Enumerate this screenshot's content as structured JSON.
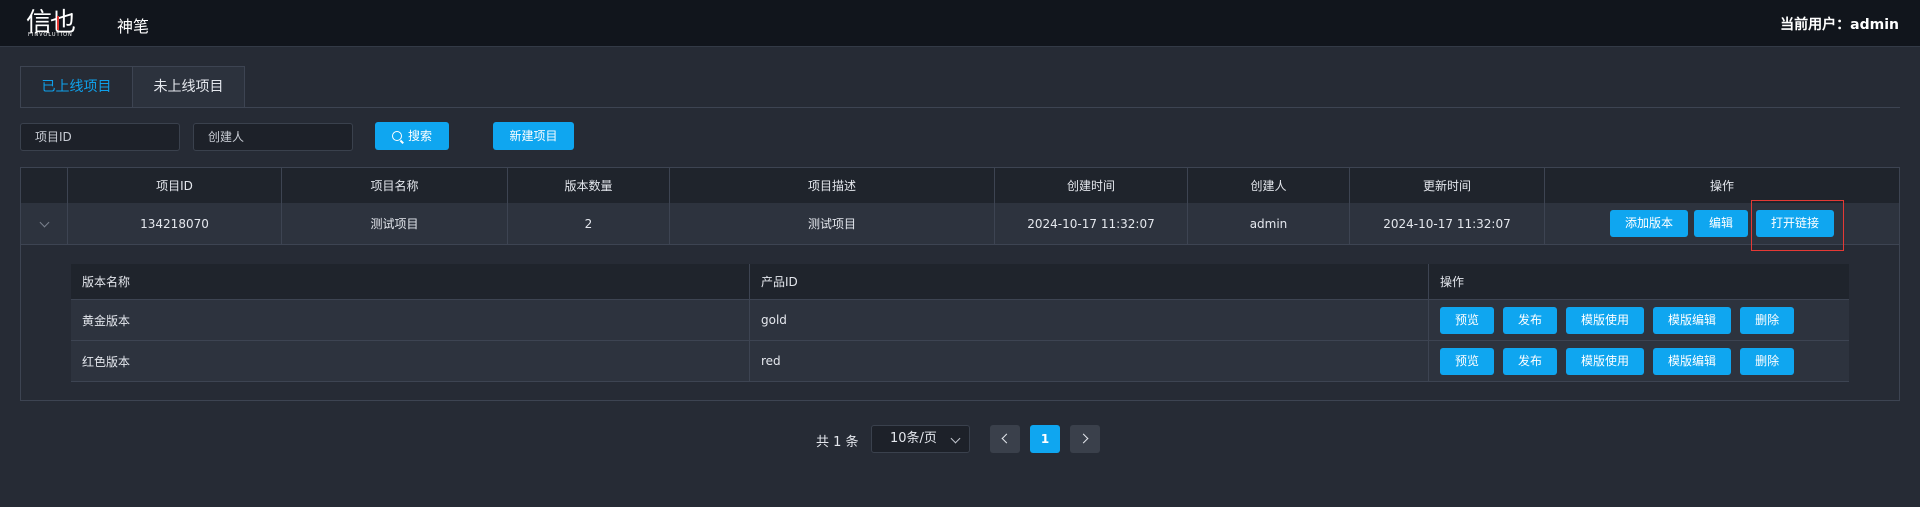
{
  "header": {
    "logo_text": "信也",
    "logo_sub": "FINVOLUTION",
    "app_name": "神笔",
    "user_info": "当前用户：admin"
  },
  "tabs": [
    {
      "label": "已上线项目",
      "active": true
    },
    {
      "label": "未上线项目",
      "active": false
    }
  ],
  "filters": {
    "project_id_placeholder": "项目ID",
    "creator_placeholder": "创建人",
    "search_label": "搜索",
    "new_project_label": "新建项目"
  },
  "table": {
    "columns": [
      "",
      "项目ID",
      "项目名称",
      "版本数量",
      "项目描述",
      "创建时间",
      "创建人",
      "更新时间",
      "操作"
    ],
    "rows": [
      {
        "project_id": "134218070",
        "project_name": "测试项目",
        "version_count": "2",
        "description": "测试项目",
        "created_at": "2024-10-17 11:32:07",
        "creator": "admin",
        "updated_at": "2024-10-17 11:32:07",
        "actions": [
          "添加版本",
          "编辑",
          "打开链接"
        ]
      }
    ]
  },
  "versions": {
    "columns": [
      "版本名称",
      "产品ID",
      "操作"
    ],
    "rows": [
      {
        "name": "黄金版本",
        "product_id": "gold",
        "actions": [
          "预览",
          "发布",
          "模版使用",
          "模版编辑",
          "删除"
        ]
      },
      {
        "name": "红色版本",
        "product_id": "red",
        "actions": [
          "预览",
          "发布",
          "模版使用",
          "模版编辑",
          "删除"
        ]
      }
    ]
  },
  "pagination": {
    "total": "共 1 条",
    "page_size": "10条/页",
    "current_page": "1"
  },
  "colors": {
    "accent": "#0fa6f0",
    "highlight": "#e53935",
    "background": "#262b35"
  }
}
